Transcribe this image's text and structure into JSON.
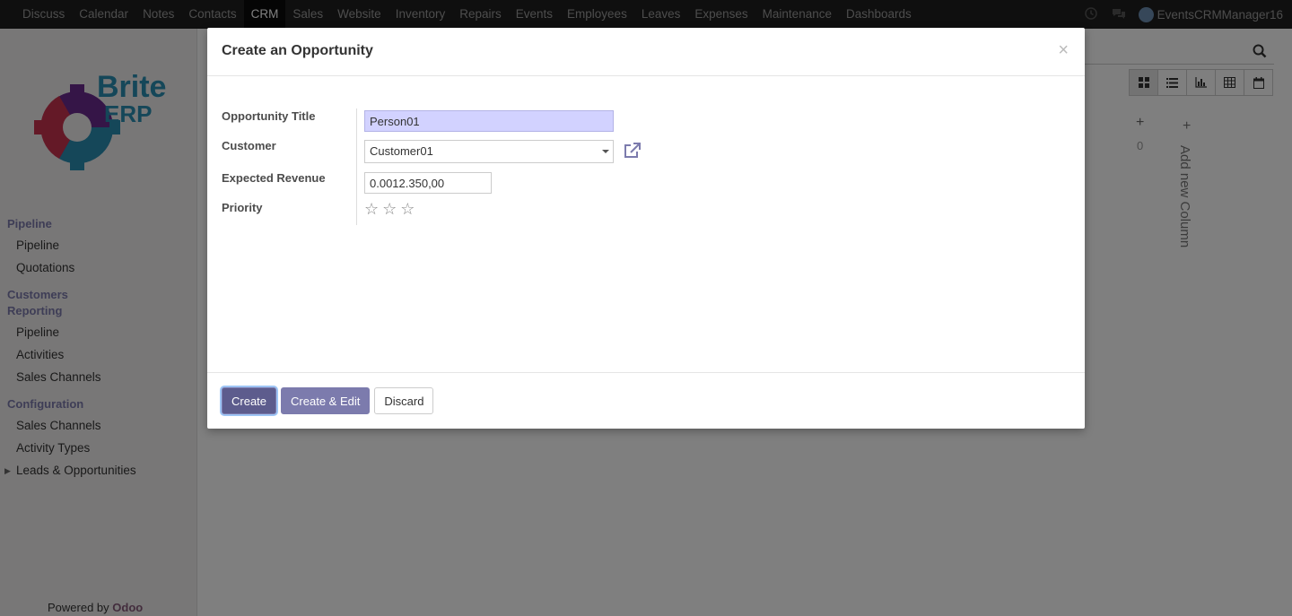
{
  "navbar": {
    "menu": [
      "Discuss",
      "Calendar",
      "Notes",
      "Contacts",
      "CRM",
      "Sales",
      "Website",
      "Inventory",
      "Repairs",
      "Events",
      "Employees",
      "Leaves",
      "Expenses",
      "Maintenance",
      "Dashboards"
    ],
    "active": "CRM",
    "user": "EventsCRMManager16"
  },
  "sidebar": {
    "logo_text_1": "Brite",
    "logo_text_2": "ERP",
    "sections": [
      {
        "title": "Pipeline",
        "items": [
          "Pipeline",
          "Quotations"
        ]
      },
      {
        "title": "Customers",
        "items": []
      },
      {
        "title": "Reporting",
        "items": [
          "Pipeline",
          "Activities",
          "Sales Channels"
        ]
      },
      {
        "title": "Configuration",
        "items": [
          "Sales Channels",
          "Activity Types",
          "Leads & Opportunities"
        ]
      }
    ],
    "powered_prefix": "Powered by ",
    "powered_brand": "Odoo"
  },
  "kanban": {
    "plus": "+",
    "count": "0",
    "add_column": "Add new Column"
  },
  "modal": {
    "title": "Create an Opportunity",
    "close": "×",
    "labels": {
      "title": "Opportunity Title",
      "customer": "Customer",
      "revenue": "Expected Revenue",
      "priority": "Priority"
    },
    "values": {
      "title": "Person01",
      "customer": "Customer01",
      "revenue": "0.0012.350,00"
    },
    "priority_stars": 3,
    "buttons": {
      "create": "Create",
      "create_edit": "Create & Edit",
      "discard": "Discard"
    }
  },
  "colors": {
    "accent": "#7c7bad",
    "highlight_field": "#d2d2ff"
  }
}
